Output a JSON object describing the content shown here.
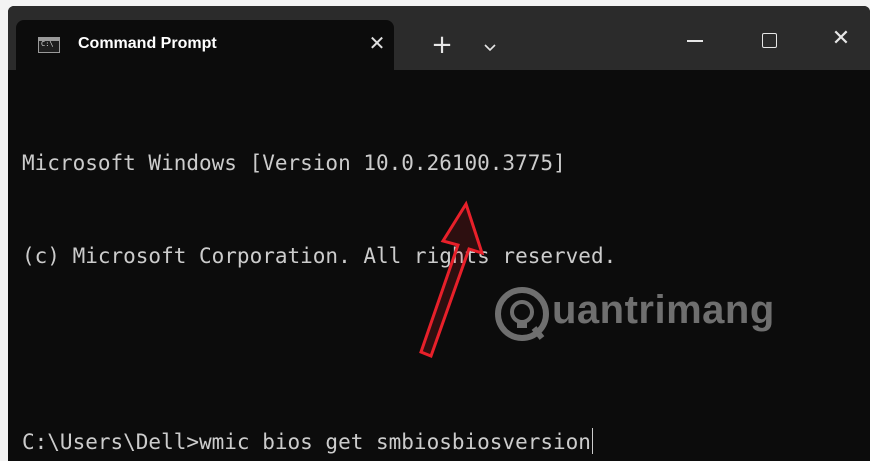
{
  "window": {
    "tab_title": "Command Prompt",
    "close_tab_glyph": "✕",
    "new_tab_glyph": "+",
    "close_window_glyph": "✕"
  },
  "console": {
    "lines": [
      "Microsoft Windows [Version 10.0.26100.3775]",
      "(c) Microsoft Corporation. All rights reserved.",
      "",
      "C:\\Users\\Dell>wmic bios get smbiosbiosversion"
    ]
  },
  "watermark": {
    "text": "uantrimang"
  },
  "colors": {
    "titlebar": "#2b2b2b",
    "terminal_bg": "#0c0c0c",
    "terminal_text": "#cccccc",
    "annotation_arrow": "#e8202a",
    "watermark": "#6f6f6f"
  },
  "icons": [
    "cmd-app-icon",
    "close-icon",
    "plus-icon",
    "chevron-down-icon",
    "minimize-icon",
    "maximize-icon",
    "close-icon",
    "arrow-annotation",
    "quantrimang-logo-icon"
  ]
}
